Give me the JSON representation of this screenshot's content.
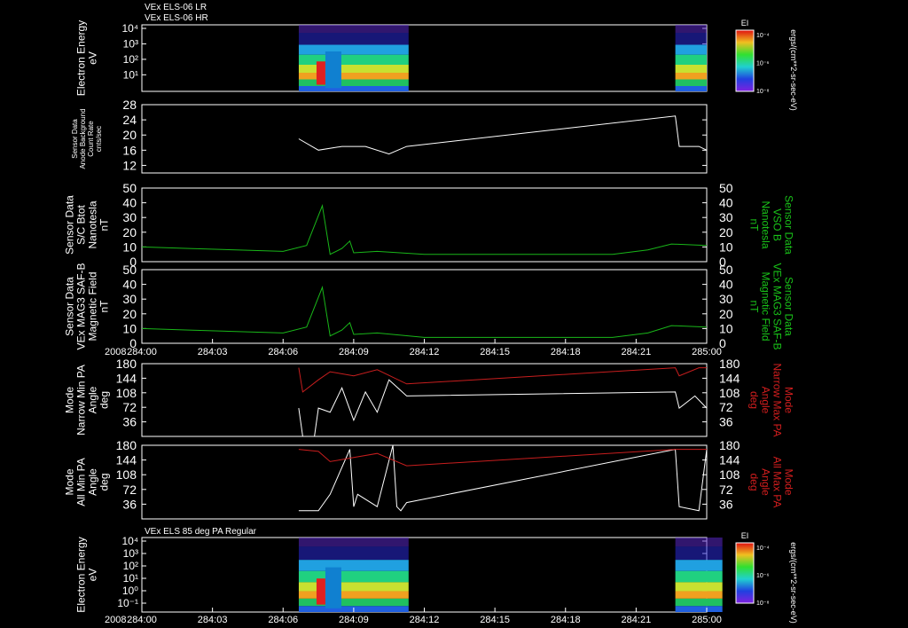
{
  "titles": {
    "top_line1": "VEx ELS-06 LR",
    "top_line2": "VEx ELS-06 HR",
    "bottom": "VEx ELS 85 deg PA Regular"
  },
  "year": "2008",
  "colorbar": {
    "title": "EI",
    "ticks": [
      "10⁻⁴",
      "10⁻⁶",
      "10⁻⁸"
    ],
    "unit": "ergs/(cm**2-sr-sec-eV)"
  },
  "colors": {
    "background": "#000000",
    "axis": "#ffffff",
    "trace_white": "#ffffff",
    "trace_green": "#19b619",
    "trace_red": "#c81e1e",
    "label_green": "#19c219",
    "label_red": "#d21e1e"
  },
  "chart_data": [
    {
      "id": "electron-energy-top",
      "type": "heatmap",
      "ylabel": [
        "Electron Energy",
        "eV"
      ],
      "yscale": "log",
      "yticks": [
        "10⁴",
        "10³",
        "10²",
        "10¹"
      ],
      "ylim": [
        1,
        10000
      ],
      "data_intervals": [
        [
          "284:06:40",
          "284:11:20"
        ],
        [
          "284:22:40",
          "285:00:00"
        ]
      ]
    },
    {
      "id": "anode-background",
      "type": "line",
      "ylabel": [
        "Sensor Data",
        "Anode Background",
        "Count Rate",
        "cnts/sec"
      ],
      "ylim": [
        10,
        28
      ],
      "yticks": [
        12,
        16,
        20,
        24,
        28
      ],
      "series": [
        {
          "color": "white",
          "x": [
            "284:06:40",
            "284:07:30",
            "284:08:30",
            "284:09:30",
            "284:10:30",
            "284:11:15",
            "284:22:40",
            "284:22:50",
            "284:23:40",
            "285:00:00"
          ],
          "values": [
            19,
            16,
            17,
            17,
            15,
            17,
            25,
            17,
            17,
            16
          ]
        }
      ]
    },
    {
      "id": "bmag-sc",
      "type": "line",
      "ylabel": [
        "Sensor Data",
        "S/C Btot",
        "Nanotesla",
        "nT"
      ],
      "ylabel_right": [
        "Sensor Data",
        "VSO B",
        "Nanotesla",
        "nT"
      ],
      "ylim": [
        0,
        50
      ],
      "yticks": [
        0,
        10,
        20,
        30,
        40,
        50
      ],
      "series": [
        {
          "color": "green",
          "x": [
            "284:00:00",
            "284:02:00",
            "284:04:00",
            "284:06:00",
            "284:07:00",
            "284:07:40",
            "284:08:00",
            "284:08:30",
            "284:08:50",
            "284:09:00",
            "284:10:00",
            "284:12:00",
            "284:15:00",
            "284:18:00",
            "284:20:00",
            "284:21:30",
            "284:22:30",
            "285:00:00"
          ],
          "values": [
            10,
            9,
            8,
            7,
            11,
            38,
            5,
            9,
            14,
            6,
            7,
            5,
            5,
            5,
            5,
            8,
            12,
            11
          ]
        }
      ]
    },
    {
      "id": "mag-saf",
      "type": "line",
      "ylabel": [
        "Sensor Data",
        "VEx MAG3 SAF-B",
        "Magnetic Field",
        "nT"
      ],
      "ylabel_right": [
        "Sensor Data",
        "VEx MAG3 SAF-B",
        "Magnetic Field",
        "nT"
      ],
      "ylim": [
        0,
        50
      ],
      "yticks": [
        0,
        10,
        20,
        30,
        40,
        50
      ],
      "series": [
        {
          "color": "green",
          "x": [
            "284:00:00",
            "284:02:00",
            "284:04:00",
            "284:06:00",
            "284:07:00",
            "284:07:40",
            "284:08:00",
            "284:08:30",
            "284:08:50",
            "284:09:00",
            "284:10:00",
            "284:12:00",
            "284:15:00",
            "284:18:00",
            "284:20:00",
            "284:21:30",
            "284:22:30",
            "285:00:00"
          ],
          "values": [
            10,
            9,
            8,
            7,
            11,
            38,
            5,
            9,
            14,
            6,
            7,
            4,
            4,
            4,
            4,
            7,
            12,
            11
          ]
        }
      ],
      "xticks": [
        "284:00",
        "284:03",
        "284:06",
        "284:09",
        "284:12",
        "284:15",
        "284:18",
        "284:21",
        "285:00"
      ]
    },
    {
      "id": "narrow-pa",
      "type": "line",
      "ylabel": [
        "Mode",
        "Narrow Min PA",
        "Angle",
        "deg"
      ],
      "ylabel_right": [
        "Mode",
        "Narrow Max PA",
        "Angle",
        "deg"
      ],
      "ylim": [
        0,
        180
      ],
      "yticks": [
        36,
        72,
        108,
        144,
        180
      ],
      "series": [
        {
          "color": "white",
          "x": [
            "284:06:40",
            "284:06:50",
            "284:07:20",
            "284:07:30",
            "284:08:00",
            "284:08:30",
            "284:09:00",
            "284:09:30",
            "284:10:00",
            "284:10:30",
            "284:11:15",
            "284:22:40",
            "284:22:50",
            "284:23:30",
            "284:24:00",
            "285:00:00"
          ],
          "values": [
            70,
            0,
            0,
            70,
            60,
            120,
            40,
            110,
            60,
            140,
            100,
            110,
            70,
            100,
            70,
            150
          ]
        },
        {
          "color": "red",
          "x": [
            "284:06:40",
            "284:06:50",
            "284:07:30",
            "284:08:00",
            "284:09:00",
            "284:10:00",
            "284:11:15",
            "284:22:40",
            "284:22:50",
            "284:23:40",
            "285:00:00"
          ],
          "values": [
            170,
            110,
            140,
            160,
            150,
            165,
            130,
            170,
            150,
            170,
            170
          ]
        }
      ]
    },
    {
      "id": "all-pa",
      "type": "line",
      "ylabel": [
        "Mode",
        "All Min PA",
        "Angle",
        "deg"
      ],
      "ylabel_right": [
        "Mode",
        "All Max PA",
        "Angle",
        "deg"
      ],
      "ylim": [
        0,
        180
      ],
      "yticks": [
        36,
        72,
        108,
        144,
        180
      ],
      "series": [
        {
          "color": "white",
          "x": [
            "284:06:40",
            "284:07:30",
            "284:08:00",
            "284:08:50",
            "284:09:00",
            "284:09:10",
            "284:10:00",
            "284:10:40",
            "284:10:50",
            "284:11:00",
            "284:11:15",
            "284:22:40",
            "284:22:50",
            "284:23:40",
            "285:00:00"
          ],
          "values": [
            20,
            20,
            60,
            170,
            30,
            60,
            30,
            180,
            30,
            20,
            40,
            170,
            30,
            20,
            170
          ]
        },
        {
          "color": "red",
          "x": [
            "284:06:40",
            "284:07:30",
            "284:08:00",
            "284:09:00",
            "284:10:00",
            "284:11:15",
            "284:22:40",
            "285:00:00"
          ],
          "values": [
            170,
            165,
            140,
            150,
            160,
            130,
            170,
            170
          ]
        }
      ]
    },
    {
      "id": "electron-energy-85pa",
      "type": "heatmap",
      "ylabel": [
        "Electron Energy",
        "eV"
      ],
      "yscale": "log",
      "yticks": [
        "10⁴",
        "10³",
        "10²",
        "10¹",
        "10⁰",
        "10⁻¹"
      ],
      "ylim": [
        0.1,
        10000
      ],
      "data_intervals": [
        [
          "284:06:40",
          "284:11:20"
        ],
        [
          "284:22:40",
          "284:24:40"
        ]
      ],
      "xticks": [
        "284:00",
        "284:03",
        "284:06",
        "284:09",
        "284:12",
        "284:15",
        "284:18",
        "284:21",
        "285:00"
      ]
    }
  ]
}
